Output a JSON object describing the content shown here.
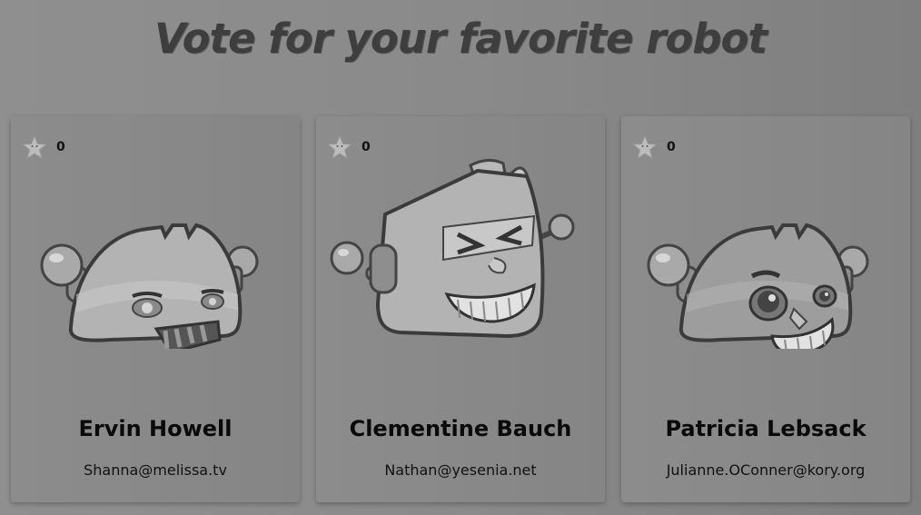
{
  "page": {
    "title": "Vote for your favorite robot"
  },
  "robots": [
    {
      "name": "Ervin Howell",
      "email": "Shanna@melissa.tv",
      "votes": "0"
    },
    {
      "name": "Clementine Bauch",
      "email": "Nathan@yesenia.net",
      "votes": "0"
    },
    {
      "name": "Patricia Lebsack",
      "email": "Julianne.OConner@kory.org",
      "votes": "0"
    }
  ],
  "icons": {
    "vote": "star-icon",
    "avatar": "robot-avatar"
  }
}
